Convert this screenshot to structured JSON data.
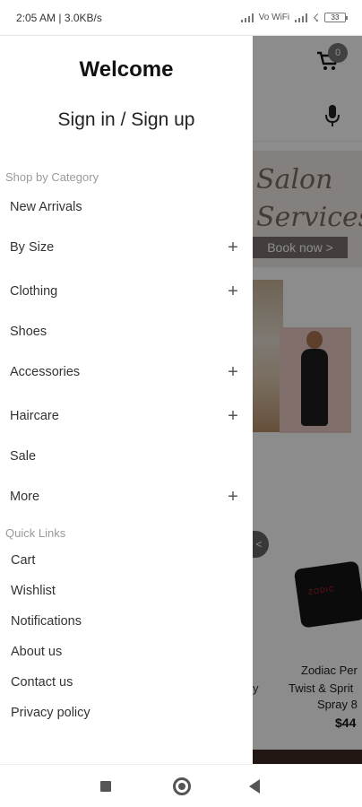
{
  "status_bar": {
    "time_speed": "2:05 AM | 3.0KB/s",
    "network_label": "Vo WiFi",
    "battery_level": "33"
  },
  "background_app": {
    "cart_count": "0",
    "banner_script": "Salon Services",
    "banner_button": "Book now >",
    "product_name_lines": [
      "Zodiac Per",
      "Twist & Sprit",
      "Spray 8"
    ],
    "product_price": "$44",
    "left_fragment": "y",
    "carousel_arrow": "<"
  },
  "drawer": {
    "welcome_title": "Welcome",
    "signin_link": "Sign in / Sign up",
    "shop_label": "Shop by Category",
    "categories": [
      {
        "label": "New Arrivals",
        "expand_icon": ""
      },
      {
        "label": "By Size",
        "expand_icon": "+"
      },
      {
        "label": "Clothing",
        "expand_icon": "+"
      },
      {
        "label": "Shoes",
        "expand_icon": ""
      },
      {
        "label": "Accessories",
        "expand_icon": "+"
      },
      {
        "label": "Haircare",
        "expand_icon": "+"
      },
      {
        "label": "Sale",
        "expand_icon": ""
      },
      {
        "label": "More",
        "expand_icon": "+"
      }
    ],
    "quick_links_label": "Quick Links",
    "quick_links": [
      "Cart",
      "Wishlist",
      "Notifications",
      "About us",
      "Contact us",
      "Privacy policy"
    ]
  },
  "colors": {
    "overlay": "#000000",
    "drawer_bg": "#ffffff",
    "section_label": "#9a9a9a"
  }
}
